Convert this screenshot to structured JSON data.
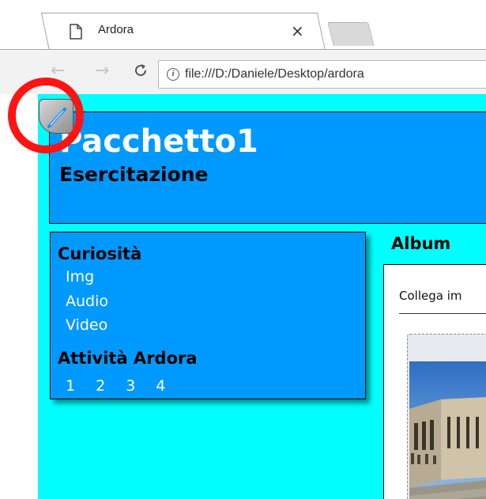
{
  "browser": {
    "tab_title": "Ardora",
    "tab_close": "×",
    "back_symbol": "←",
    "forward_symbol": "→",
    "reload_symbol": "C",
    "info_symbol": "i",
    "url": "file:///D:/Daniele/Desktop/ardora"
  },
  "page": {
    "background_color": "#00ffff",
    "accent_color": "#0099ff",
    "header": {
      "title": "Pacchetto1",
      "subtitle": "Esercitazione"
    },
    "sidebar": {
      "section1_heading": "Curiosità",
      "links": [
        "Img",
        "Audio",
        "Video"
      ],
      "section2_heading": "Attività Ardora",
      "activity_links": [
        "1",
        "2",
        "3",
        "4"
      ]
    },
    "album": {
      "title": "Album",
      "collega_text": "Collega im"
    }
  },
  "annotation": {
    "color": "#ff1414"
  }
}
